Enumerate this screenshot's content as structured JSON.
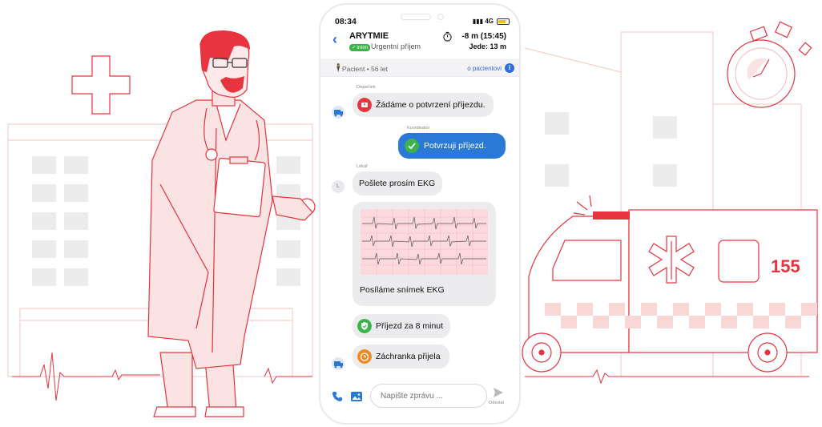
{
  "status_bar": {
    "time": "08:34",
    "network": "4G"
  },
  "header": {
    "title": "ARYTMIE",
    "badge": "intim",
    "subtitle": "Urgentní příjem",
    "timer": "-8 m (15:45)",
    "eta": "Jede: 13 m"
  },
  "patient_bar": {
    "text": "Pacient • 56 let",
    "link": "o pacientovi"
  },
  "messages": [
    {
      "sender": "Dispečink",
      "text": "Žádáme o potvrzení příjezdu.",
      "icon": "alert-icon",
      "direction": "in"
    },
    {
      "sender": "Koordinátor",
      "text": "Potvrzuji příjezd.",
      "icon": "check-icon",
      "direction": "out"
    },
    {
      "sender": "Lékař",
      "avatar": "L",
      "text": "Pošlete prosím EKG",
      "direction": "in"
    },
    {
      "text": "Posíláme snímek EKG",
      "attachment": "ekg-image",
      "direction": "in"
    },
    {
      "text": "Příjezd za 8 minut",
      "icon": "shield-check-icon",
      "direction": "in"
    },
    {
      "text": "Záchranka přijela",
      "icon": "alarm-clock-icon",
      "direction": "in"
    }
  ],
  "composer": {
    "placeholder": "Napište zprávu ...",
    "send_label": "Odeslat"
  },
  "illustration": {
    "ambulance_number": "155"
  },
  "colors": {
    "accent_red": "#e8343e",
    "blue": "#2b79d6",
    "green": "#3bb54a",
    "orange": "#f08a24",
    "light_red": "#f9d7d7"
  }
}
